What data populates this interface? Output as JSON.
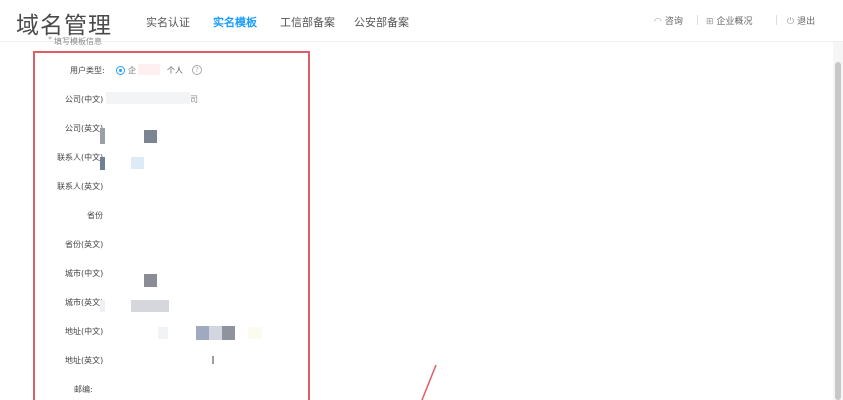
{
  "header": {
    "logo": "域名管理",
    "tabs": [
      {
        "label": "实名认证",
        "active": false
      },
      {
        "label": "实名模板",
        "active": true
      },
      {
        "label": "工信部备案",
        "active": false
      },
      {
        "label": "公安部备案",
        "active": false
      }
    ],
    "consult_label": "咨询",
    "enterprise_label": "企业概况",
    "logout_label": "退出"
  },
  "caption": "填写模板信息",
  "form": {
    "user_type_label": "用户类型:",
    "user_type_options": [
      "企",
      "个人"
    ],
    "company_cn_label": "公司(中文)",
    "company_cn_partial": "司",
    "company_en_label": "公司(英文)",
    "contact_cn_label": "联系人(中文)",
    "contact_en_label": "联系人(英文)",
    "province_label": "省份",
    "province_en_label": "省份(英文)",
    "city_cn_label": "城市(中文)",
    "city_en_label": "城市(英文)",
    "address_cn_label": "地址(中文)",
    "address_en_label": "地址(英文)",
    "postcode_label": "邮编:"
  },
  "colors": {
    "accent": "#1e9fff",
    "highlight_border": "#e05c66"
  }
}
